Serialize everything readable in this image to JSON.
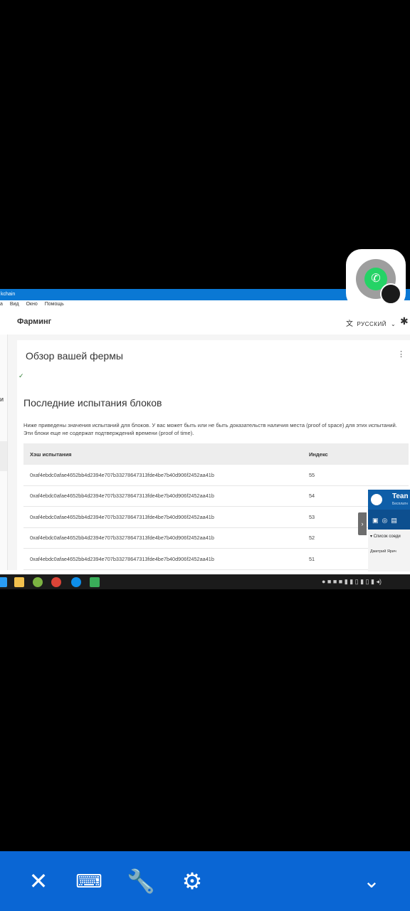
{
  "remote_window": {
    "title": "kchain",
    "menu": [
      "а",
      "Вид",
      "Окно",
      "Помощь"
    ],
    "page_title": "Фарминг",
    "language": "РУССКИЙ",
    "sidebar_letter": "и",
    "overview_title": "Обзор вашей фермы",
    "blocks_title": "Последние испытания блоков",
    "description": "Ниже приведены значения испытаний для блоков. У вас может быть или не быть доказательств наличия места (proof of space) для этих испытаний. Эти блоки еще не содержат подтверждений времени (proof of time).",
    "table": {
      "headers": [
        "Хэш испытания",
        "Индекс"
      ],
      "rows": [
        {
          "hash": "0xaf4ebdc0afae4652bb4d2394e707b33278647313fde4be7b40d906f2452aa41b",
          "index": "55"
        },
        {
          "hash": "0xaf4ebdc0afae4652bb4d2394e707b33278647313fde4be7b40d906f2452aa41b",
          "index": "54"
        },
        {
          "hash": "0xaf4ebdc0afae4652bb4d2394e707b33278647313fde4be7b40d906f2452aa41b",
          "index": "53"
        },
        {
          "hash": "0xaf4ebdc0afae4652bb4d2394e707b33278647313fde4be7b40d906f2452aa41b",
          "index": "52"
        },
        {
          "hash": "0xaf4ebdc0afae4652bb4d2394e707b33278647313fde4be7b40d906f2452aa41b",
          "index": "51"
        }
      ]
    }
  },
  "teamviewer": {
    "name": "Tean",
    "subtitle": "Бесплатн",
    "list_label": "Список соеди",
    "user": "Дмитрий Ярич"
  },
  "taskbar": {
    "apps": [
      "file-explorer-icon",
      "utorrent-icon",
      "chrome-icon",
      "teamviewer-icon",
      "chia-icon"
    ]
  },
  "toolbar": {
    "buttons": [
      "close-icon",
      "keyboard-icon",
      "wrench-icon",
      "settings-icon",
      "chevron-down-icon"
    ]
  },
  "colors": {
    "accent": "#0a66d4",
    "titlebar": "#0a78d4",
    "whatsapp": "#25d366"
  }
}
